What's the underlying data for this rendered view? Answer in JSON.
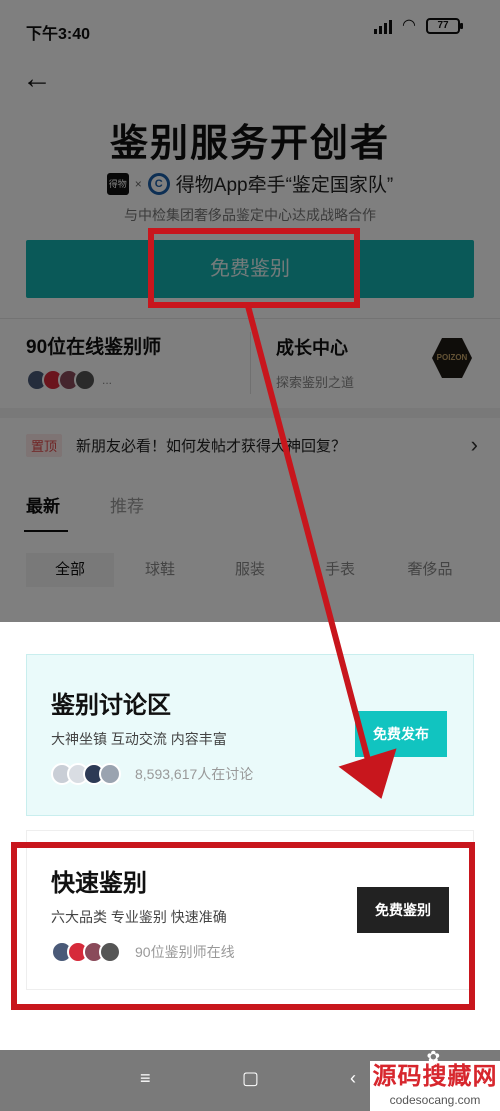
{
  "status": {
    "time": "下午3:40",
    "battery": "77"
  },
  "hero": {
    "title": "鉴别服务开创者",
    "brand_dw": "得物",
    "brand_x": "×",
    "brand_c": "C",
    "subtitle": "得物App牵手“鉴定国家队”",
    "note": "与中检集团奢侈品鉴定中心达成战略合作",
    "button": "免费鉴别"
  },
  "stats": {
    "appraisers": "90位在线鉴别师",
    "more": "...",
    "growth_title": "成长中心",
    "growth_sub": "探索鉴别之道",
    "poizon": "POIZON"
  },
  "pinned": {
    "tag": "置顶",
    "text": "新朋友必看！如何发帖才获得大神回复？",
    "arrow": "›"
  },
  "tabs": [
    "最新",
    "推荐"
  ],
  "categories": [
    "全部",
    "球鞋",
    "服装",
    "手表",
    "奢侈品"
  ],
  "cards": [
    {
      "title": "鉴别讨论区",
      "desc": "大神坐镇 互动交流 内容丰富",
      "count": "8,593,617人在讨论",
      "button": "免费发布"
    },
    {
      "title": "快速鉴别",
      "desc": "六大品类 专业鉴别 快速准确",
      "count": "90位鉴别师在线",
      "button": "免费鉴别"
    }
  ],
  "nav": {
    "menu": "≡",
    "home": "▢",
    "back": "‹"
  },
  "watermark": {
    "main": "源码搜藏网",
    "url": "codesocang.com"
  },
  "colors": {
    "accent": "#14b3b0",
    "highlight": "#c8161d",
    "dark_button": "#222222"
  }
}
